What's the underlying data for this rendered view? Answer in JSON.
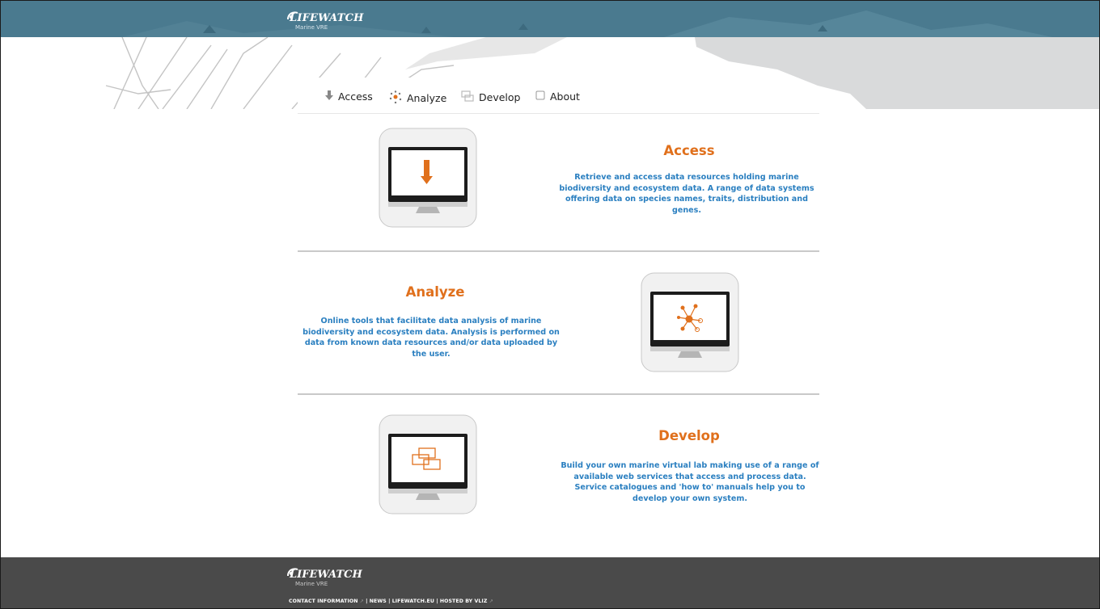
{
  "brand": {
    "name": "LIFEWATCH",
    "subtitle": "Marine VRE"
  },
  "nav": {
    "items": [
      {
        "label": "Access",
        "icon": "download-arrow-icon"
      },
      {
        "label": "Analyze",
        "icon": "network-nodes-icon"
      },
      {
        "label": "Develop",
        "icon": "windows-icon"
      },
      {
        "label": "About",
        "icon": "square-icon"
      }
    ]
  },
  "sections": [
    {
      "title": "Access",
      "text": "Retrieve and access data resources holding marine biodiversity and ecosystem data. A range of data systems offering data on species names, traits, distribution and genes.",
      "icon": "download-arrow-icon"
    },
    {
      "title": "Analyze",
      "text": "Online tools that facilitate data analysis of marine biodiversity and ecosystem data. Analysis is performed on data from known data resources and/or data uploaded by the user.",
      "icon": "network-nodes-icon"
    },
    {
      "title": "Develop",
      "text": "Build your own marine virtual lab making use of a range of available web services that access and process data. Service catalogues and 'how to' manuals help you to develop your own system.",
      "icon": "windows-icon"
    }
  ],
  "footer": {
    "links": [
      "CONTACT INFORMATION",
      "NEWS",
      "LIFEWATCH.EU",
      "HOSTED BY VLIZ"
    ],
    "separator": " | "
  },
  "colors": {
    "header": "#4a7a8f",
    "accent": "#e0701c",
    "body_text": "#2a7fc0",
    "footer": "#4a4a4a"
  }
}
